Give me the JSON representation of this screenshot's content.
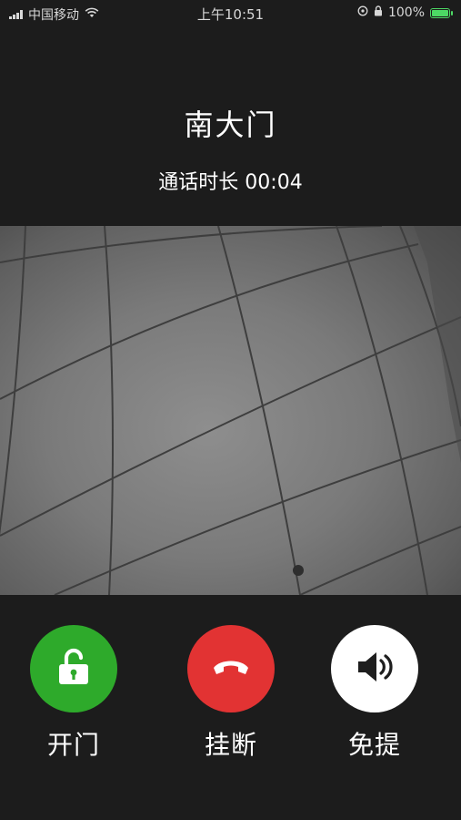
{
  "status_bar": {
    "carrier": "中国移动",
    "time": "上午10:51",
    "battery": "100%"
  },
  "call": {
    "title": "南大门",
    "duration_label": "通话时长",
    "duration": "00:04"
  },
  "controls": {
    "open_door": {
      "label": "开门",
      "icon": "unlock-icon",
      "color": "#2eaa2b"
    },
    "hang_up": {
      "label": "挂断",
      "icon": "phone-hangup-icon",
      "color": "#e23333"
    },
    "speaker": {
      "label": "免提",
      "icon": "speaker-icon",
      "color": "#ffffff"
    }
  }
}
